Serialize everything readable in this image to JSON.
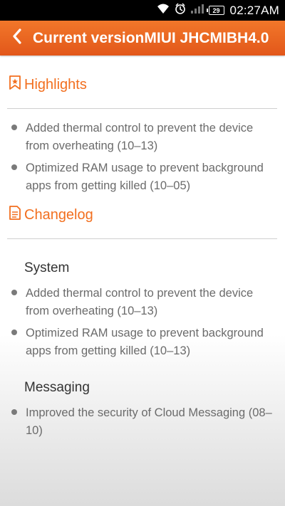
{
  "status_bar": {
    "time": "02:27AM",
    "battery": "29",
    "icons": [
      "wifi-icon",
      "alarm-icon",
      "signal-icon",
      "battery-icon"
    ]
  },
  "title_bar": {
    "title": "Current versionMIUI JHCMIBH4.0"
  },
  "highlights": {
    "label": "Highlights",
    "icon": "bookmark-star-icon",
    "items": [
      "Added thermal control to prevent the device from overheating (10–13)",
      "Optimized RAM usage to prevent background apps from getting killed (10–05)"
    ]
  },
  "changelog": {
    "label": "Changelog",
    "icon": "document-icon",
    "groups": [
      {
        "name": "System",
        "items": [
          "Added thermal control to prevent the device from overheating (10–13)",
          "Optimized RAM usage to prevent background apps from getting killed (10–13)"
        ]
      },
      {
        "name": "Messaging",
        "items": [
          "Improved the security of Cloud Messaging (08–10)"
        ]
      }
    ]
  },
  "colors": {
    "accent": "#f26f1f",
    "title_bar": "#e8621f",
    "bullet_text": "#6b6b6b"
  }
}
